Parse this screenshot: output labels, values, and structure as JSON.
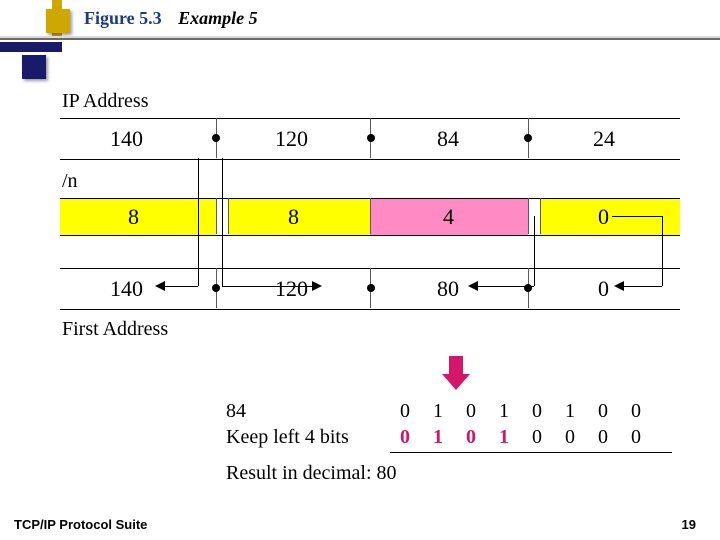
{
  "figure": {
    "number": "Figure 5.3",
    "title": "Example 5"
  },
  "labels": {
    "ip": "IP Address",
    "mask": "/n",
    "first": "First Address",
    "keep": "Keep left 4 bits",
    "byte": "84",
    "result": "Result in decimal: 80"
  },
  "ip_octets": [
    "140",
    "120",
    "84",
    "24"
  ],
  "mask_octets": [
    "8",
    "8",
    "4",
    "0"
  ],
  "first_octets": [
    "140",
    "120",
    "80",
    "0"
  ],
  "bits_orig": [
    "0",
    "1",
    "0",
    "1",
    "0",
    "1",
    "0",
    "0"
  ],
  "bits_kept": [
    "0",
    "1",
    "0",
    "1",
    "0",
    "0",
    "0",
    "0"
  ],
  "footer": {
    "left": "TCP/IP Protocol Suite",
    "page": "19"
  }
}
